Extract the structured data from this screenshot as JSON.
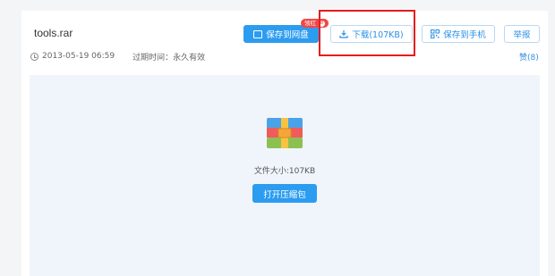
{
  "file": {
    "name": "tools.rar",
    "upload_time": "2013-05-19 06:59",
    "expire_label": "过期时间：永久有效"
  },
  "toolbar": {
    "save_label": "保存到网盘",
    "save_badge_text": "领红",
    "save_badge_count": "8",
    "download_label": "下载(107KB)",
    "save_phone_label": "保存到手机",
    "report_label": "举报",
    "like_label": "赞(8)"
  },
  "preview": {
    "size_text": "文件大小:107KB",
    "open_label": "打开压缩包",
    "icon": "archive-icon"
  },
  "colors": {
    "primary": "#2c9cf0",
    "highlight": "#e51d1d",
    "badge": "#f04848"
  }
}
